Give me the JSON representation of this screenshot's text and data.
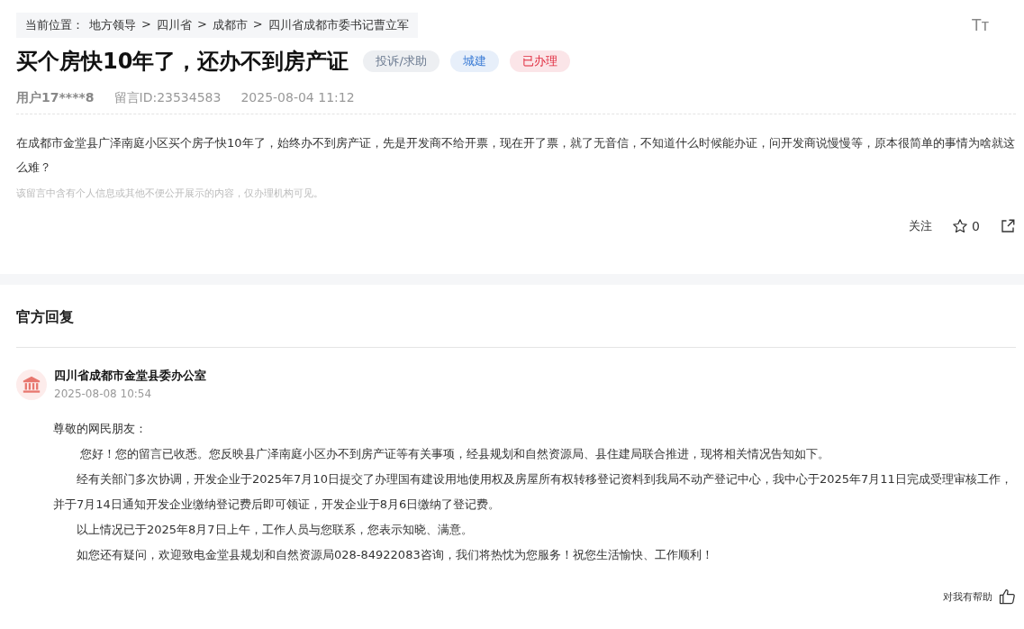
{
  "breadcrumb": {
    "label": "当前位置：",
    "separator": ">",
    "items": [
      "地方领导",
      "四川省",
      "成都市",
      "四川省成都市委书记曹立军"
    ]
  },
  "font_size_button": "Tт",
  "title": "买个房快10年了，还办不到房产证",
  "tags": [
    {
      "label": "投诉/求助",
      "color": "#6b7a90"
    },
    {
      "label": "城建",
      "color": "#3a7bd5"
    },
    {
      "label": "已办理",
      "color": "#e0283c"
    }
  ],
  "meta": {
    "user": "用户17****8",
    "message_id": "留言ID:23534583",
    "time": "2025-08-04 11:12"
  },
  "message": "在成都市金堂县广泽南庭小区买个房子快10年了，始终办不到房产证，先是开发商不给开票，现在开了票，就了无音信，不知道什么时候能办证，问开发商说慢慢等，原本很简单的事情为啥就这么难？",
  "privacy_note": "该留言中含有个人信息或其他不便公开展示的内容，仅办理机构可见。",
  "actions": {
    "follow": "关注",
    "star_count": "0"
  },
  "reply": {
    "heading": "官方回复",
    "org": "四川省成都市金堂县委办公室",
    "time": "2025-08-08 10:54",
    "paragraphs": [
      {
        "kind": "greeting",
        "text": "尊敬的网民朋友："
      },
      {
        "kind": "indent",
        "text": " 您好！您的留言已收悉。您反映县广泽南庭小区办不到房产证等有关事项，经县规划和自然资源局、县住建局联合推进，现将相关情况告知如下。"
      },
      {
        "kind": "indent",
        "text": "经有关部门多次协调，开发企业于2025年7月10日提交了办理国有建设用地使用权及房屋所有权转移登记资料到我局不动产登记中心，我中心于2025年7月11日完成受理审核工作，并于7月14日通知开发企业缴纳登记费后即可领证，开发企业于8月6日缴纳了登记费。"
      },
      {
        "kind": "indent",
        "text": "以上情况已于2025年8月7日上午，工作人员与您联系，您表示知晓、满意。"
      },
      {
        "kind": "indent",
        "text": "如您还有疑问，欢迎致电金堂县规划和自然资源局028-84922083咨询，我们将热忱为您服务！祝您生活愉快、工作顺利！"
      }
    ],
    "helpful": "对我有帮助"
  }
}
